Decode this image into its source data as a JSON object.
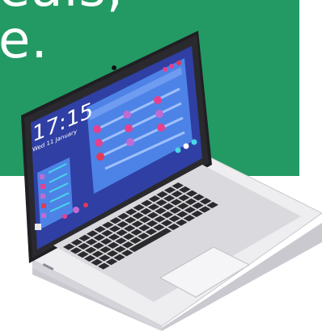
{
  "banner": {
    "line1": "eals,",
    "line2": "e."
  },
  "screen": {
    "time": "17:15",
    "date": "Wed 11 January"
  },
  "colors": {
    "banner_green": "#239a63",
    "laptop_body": "#e9e9ec",
    "bezel": "#2a2a2e",
    "screen_bg": "#2f3fa4",
    "widget_bg": "#4d83e6",
    "accent_pink": "#e5418f",
    "accent_red": "#e03a58",
    "accent_violet": "#c06bd3",
    "accent_cyan": "#48d7e8",
    "keys": "#2b2b2e"
  },
  "icons": [
    "camera-icon",
    "trackpad",
    "keyboard"
  ]
}
